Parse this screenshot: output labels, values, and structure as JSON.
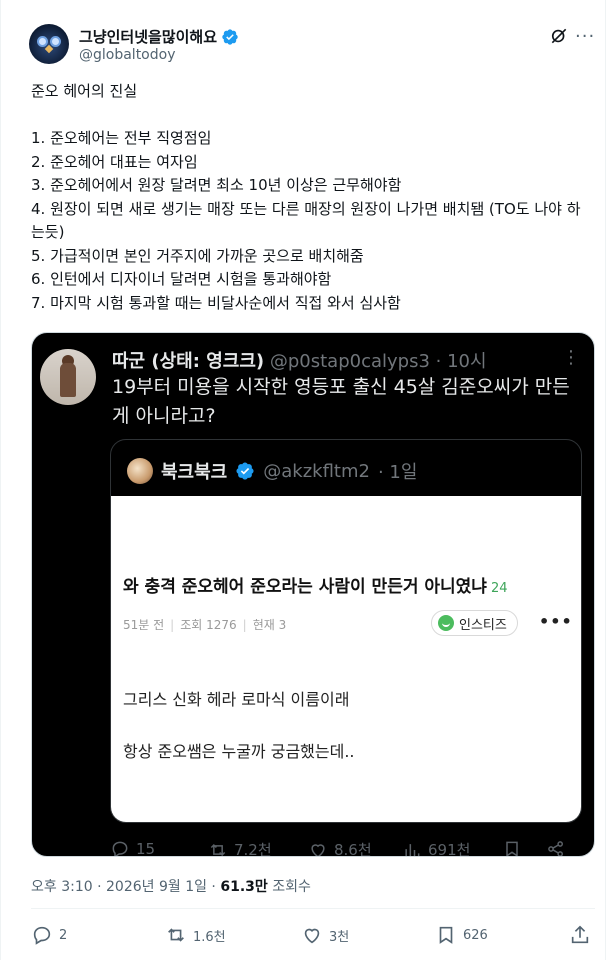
{
  "author": {
    "display_name": "그냥인터넷을많이해요",
    "handle": "@globaltodoy",
    "verified": true
  },
  "post": {
    "title": "준오 헤어의 진실",
    "lines": [
      "1. 준오헤어는 전부 직영점임",
      "2. 준오헤어 대표는 여자임",
      "3. 준오헤어에서 원장 달려면 최소 10년 이상은 근무해야함",
      "4. 원장이 되면 새로 생기는 매장 또는 다른 매장의 원장이 나가면 배치됌 (TO도 나야 하는듯)",
      "5. 가급적이면 본인 거주지에 가까운 곳으로 배치해줌",
      "6. 인턴에서 디자이너 달려면 시험을 통과해야함",
      "7. 마지막 시험 통과할 때는 비달사순에서 직접 와서 심사함"
    ]
  },
  "media": {
    "author_name": "따군 (상태: 영크크)",
    "author_handle": "@p0stap0calyps3",
    "time": "· 10시",
    "text": "19부터 미용을 시작한 영등포 출신 45살 김준오씨가 만든게 아니라고?",
    "quote": {
      "name": "북크북크",
      "handle": "@akzkfltm2",
      "time": "· 1일",
      "title": "와 충격 준오헤어 준오라는 사람이 만든거 아니였냐",
      "comment_count": "24",
      "meta_time": "51분 전",
      "meta_views": "조회 1276",
      "meta_now": "현재 3",
      "source_badge": "인스티즈",
      "body_line1": "그리스 신화 헤라 로마식 이름이래",
      "body_line2": "항상 준오쌤은 누굴까 궁금했는데.."
    },
    "actions": {
      "replies": "15",
      "reposts": "7.2천",
      "likes": "8.6천",
      "views": "691천"
    }
  },
  "timestamp": {
    "time": "오후 3:10 · 2026년 9월 1일 · ",
    "views_count": "61.3만",
    "views_label": " 조회수"
  },
  "actions": {
    "replies": "2",
    "reposts": "1.6천",
    "likes": "3천",
    "bookmarks": "626"
  },
  "colors": {
    "verified": "#1d9bf0",
    "text_primary": "#0f1419",
    "text_secondary": "#536471"
  },
  "icons": [
    "grok-icon",
    "more-icon",
    "verified-icon",
    "reply-icon",
    "repost-icon",
    "like-icon",
    "bookmark-icon",
    "share-icon",
    "views-icon"
  ]
}
